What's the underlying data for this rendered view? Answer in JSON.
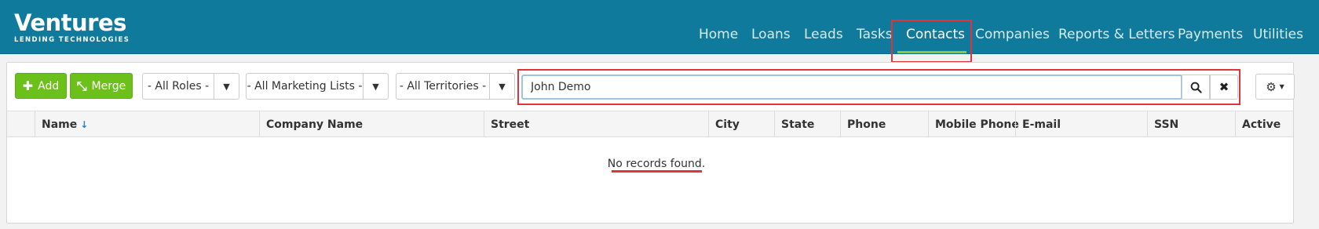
{
  "brand": {
    "name": "Ventures",
    "tagline": "LENDING TECHNOLOGIES"
  },
  "nav": {
    "items": [
      "Home",
      "Loans",
      "Leads",
      "Tasks",
      "Contacts",
      "Companies",
      "Reports & Letters",
      "Payments",
      "Utilities"
    ],
    "active": "Contacts"
  },
  "toolbar": {
    "add_label": "Add",
    "merge_label": "Merge",
    "roles_filter": "- All Roles -",
    "marketing_filter": "- All Marketing Lists -",
    "territories_filter": "- All Territories -",
    "search_value": "John Demo"
  },
  "table": {
    "columns": [
      "Name",
      "Company Name",
      "Street",
      "City",
      "State",
      "Phone",
      "Mobile Phone",
      "E-mail",
      "SSN",
      "Active"
    ],
    "sorted_column": "Name",
    "sort_direction": "ascending",
    "empty_message": "No records found."
  },
  "colors": {
    "header": "#0f7a9c",
    "accent_green": "#6cc01a",
    "highlight": "#e0333c"
  },
  "icons": [
    "plus-icon",
    "merge-icon",
    "caret-down-icon",
    "search-icon",
    "close-icon",
    "gear-icon",
    "sort-down-icon"
  ]
}
